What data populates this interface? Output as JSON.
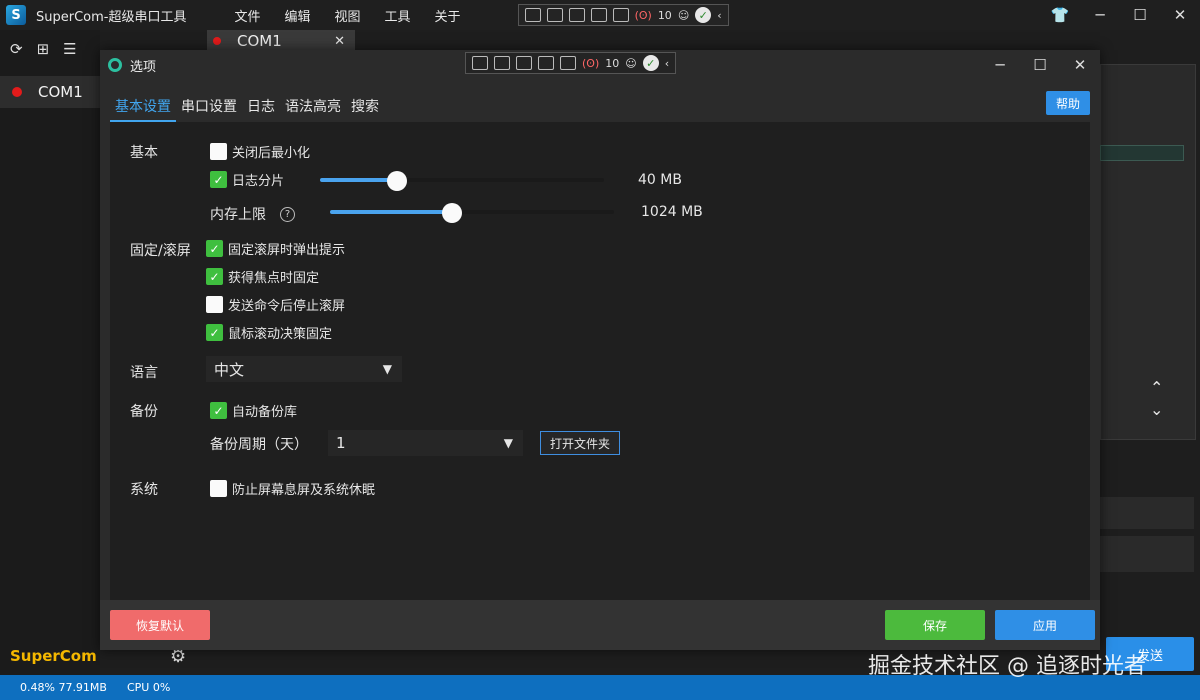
{
  "app": {
    "title": "SuperCom-超级串口工具",
    "menu": [
      "文件",
      "编辑",
      "视图",
      "工具",
      "关于"
    ],
    "debug_count": "10",
    "brand": "SuperCom",
    "port": "COM1",
    "tab_label": "COM1"
  },
  "status": {
    "memory": "0.48% 77.91MB",
    "cpu": "CPU 0%"
  },
  "send_button": "发送",
  "watermark": "掘金技术社区 @ 追逐时光者",
  "dialog": {
    "title": "选项",
    "tabs": [
      "基本设置",
      "串口设置",
      "日志",
      "语法高亮",
      "搜索"
    ],
    "help": "帮助",
    "sections": {
      "basic": "基本",
      "fixed_scroll": "固定/滚屏",
      "language": "语言",
      "backup": "备份",
      "system": "系统"
    },
    "basic": {
      "minimize_on_close": {
        "label": "关闭后最小化",
        "checked": false
      },
      "log_split": {
        "label": "日志分片",
        "checked": true,
        "value": "40 MB",
        "level": 0.27
      },
      "memory_limit": {
        "label": "内存上限",
        "value": "1024 MB",
        "level": 0.43
      }
    },
    "fixed_scroll": [
      {
        "label": "固定滚屏时弹出提示",
        "checked": true
      },
      {
        "label": "获得焦点时固定",
        "checked": true
      },
      {
        "label": "发送命令后停止滚屏",
        "checked": false
      },
      {
        "label": "鼠标滚动决策固定",
        "checked": true
      }
    ],
    "language_value": "中文",
    "backup": {
      "auto_backup": {
        "label": "自动备份库",
        "checked": true
      },
      "period_label": "备份周期（天）",
      "period_value": "1",
      "open_folder": "打开文件夹"
    },
    "system": {
      "prevent_sleep": {
        "label": "防止屏幕息屏及系统休眠",
        "checked": false
      }
    },
    "footer": {
      "reset": "恢复默认",
      "save": "保存",
      "apply": "应用"
    }
  }
}
